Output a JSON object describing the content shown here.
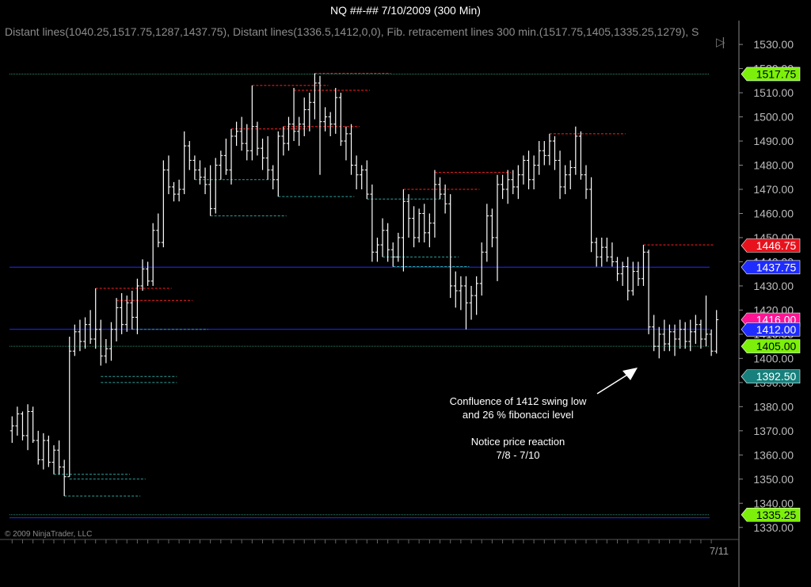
{
  "title": "NQ ##-##  7/10/2009 (300 Min)",
  "subtitle": "Distant lines(1040.25,1517.75,1287,1437.75), Distant lines(1336.5,1412,0,0), Fib. retracement lines 300 min.(1517.75,1405,1335.25,1279), S",
  "copyright": "© 2009 NinjaTrader, LLC",
  "annotation": {
    "lines": [
      "Confluence of 1412 swing low",
      "and 26 % fibonacci level",
      "",
      "Notice price reaction",
      "7/8 - 7/10"
    ]
  },
  "colors": {
    "background": "#000000",
    "bars": "#ffffff",
    "swing_high": "#ff2020",
    "swing_low": "#2aa39c",
    "blue_line": "#1f2cff",
    "fib_line": "#2e8c73",
    "axis": "#bbbbbb"
  },
  "chart_data": {
    "type": "ohlc",
    "instrument": "NQ ##-##",
    "timeframe": "300 Min",
    "y_axis": {
      "min": 1325,
      "max": 1532,
      "ticks": [
        1330,
        1340,
        1350,
        1360,
        1370,
        1380,
        1390,
        1400,
        1410,
        1420,
        1430,
        1440,
        1450,
        1460,
        1470,
        1480,
        1490,
        1500,
        1510,
        1520,
        1530
      ],
      "tick_labels": [
        "1330.00",
        "1340.00",
        "1350.00",
        "1360.00",
        "1370.00",
        "1380.00",
        "1390.00",
        "1400.00",
        "1410.00",
        "1420.00",
        "1430.00",
        "1440.00",
        "1450.00",
        "1460.00",
        "1470.00",
        "1480.00",
        "1490.00",
        "1500.00",
        "1510.00",
        "1520.00",
        "1530.00"
      ]
    },
    "x_axis": {
      "labels": [
        "7/11"
      ]
    },
    "bars": [
      [
        1370,
        1376,
        1365,
        1372
      ],
      [
        1372,
        1380,
        1368,
        1377
      ],
      [
        1377,
        1378,
        1366,
        1368
      ],
      [
        1368,
        1381,
        1362,
        1378
      ],
      [
        1378,
        1380,
        1365,
        1366
      ],
      [
        1366,
        1370,
        1356,
        1358
      ],
      [
        1358,
        1369,
        1354,
        1366
      ],
      [
        1366,
        1368,
        1355,
        1357
      ],
      [
        1357,
        1364,
        1352,
        1362
      ],
      [
        1362,
        1366,
        1352,
        1355
      ],
      [
        1355,
        1358,
        1343,
        1351
      ],
      [
        1351,
        1409,
        1351,
        1403
      ],
      [
        1403,
        1414,
        1401,
        1411
      ],
      [
        1411,
        1416,
        1403,
        1407
      ],
      [
        1407,
        1417,
        1404,
        1414
      ],
      [
        1414,
        1420,
        1406,
        1408
      ],
      [
        1408,
        1429,
        1404,
        1412
      ],
      [
        1412,
        1416,
        1397,
        1401
      ],
      [
        1401,
        1408,
        1398,
        1404
      ],
      [
        1404,
        1415,
        1399,
        1412
      ],
      [
        1412,
        1425,
        1407,
        1421
      ],
      [
        1421,
        1427,
        1410,
        1414
      ],
      [
        1414,
        1426,
        1411,
        1423
      ],
      [
        1423,
        1428,
        1412,
        1417
      ],
      [
        1417,
        1433,
        1410,
        1430
      ],
      [
        1430,
        1441,
        1428,
        1437
      ],
      [
        1437,
        1440,
        1430,
        1432
      ],
      [
        1432,
        1456,
        1430,
        1453
      ],
      [
        1453,
        1460,
        1446,
        1448
      ],
      [
        1448,
        1482,
        1446,
        1478
      ],
      [
        1478,
        1484,
        1468,
        1471
      ],
      [
        1471,
        1473,
        1465,
        1468
      ],
      [
        1468,
        1474,
        1465,
        1470
      ],
      [
        1470,
        1494,
        1468,
        1488
      ],
      [
        1488,
        1490,
        1478,
        1482
      ],
      [
        1482,
        1484,
        1474,
        1478
      ],
      [
        1478,
        1482,
        1472,
        1475
      ],
      [
        1475,
        1479,
        1468,
        1472
      ],
      [
        1472,
        1480,
        1459,
        1462
      ],
      [
        1462,
        1483,
        1460,
        1480
      ],
      [
        1480,
        1486,
        1474,
        1484
      ],
      [
        1484,
        1491,
        1476,
        1478
      ],
      [
        1478,
        1495,
        1472,
        1492
      ],
      [
        1492,
        1498,
        1488,
        1494
      ],
      [
        1494,
        1500,
        1486,
        1489
      ],
      [
        1489,
        1497,
        1482,
        1486
      ],
      [
        1486,
        1513,
        1482,
        1496
      ],
      [
        1496,
        1498,
        1484,
        1487
      ],
      [
        1487,
        1491,
        1478,
        1483
      ],
      [
        1483,
        1492,
        1474,
        1478
      ],
      [
        1478,
        1480,
        1470,
        1474
      ],
      [
        1474,
        1494,
        1467,
        1492
      ],
      [
        1492,
        1496,
        1484,
        1489
      ],
      [
        1489,
        1500,
        1486,
        1497
      ],
      [
        1497,
        1512,
        1490,
        1494
      ],
      [
        1494,
        1500,
        1488,
        1497
      ],
      [
        1497,
        1508,
        1492,
        1503
      ],
      [
        1503,
        1510,
        1494,
        1506
      ],
      [
        1506,
        1518,
        1499,
        1514
      ],
      [
        1514,
        1517,
        1476,
        1498
      ],
      [
        1498,
        1504,
        1494,
        1500
      ],
      [
        1500,
        1502,
        1492,
        1497
      ],
      [
        1497,
        1512,
        1493,
        1508
      ],
      [
        1508,
        1510,
        1488,
        1490
      ],
      [
        1490,
        1496,
        1482,
        1493
      ],
      [
        1493,
        1497,
        1476,
        1480
      ],
      [
        1480,
        1484,
        1470,
        1476
      ],
      [
        1476,
        1480,
        1470,
        1478
      ],
      [
        1478,
        1482,
        1466,
        1468
      ],
      [
        1468,
        1472,
        1440,
        1444
      ],
      [
        1444,
        1450,
        1440,
        1447
      ],
      [
        1447,
        1458,
        1442,
        1453
      ],
      [
        1453,
        1456,
        1440,
        1445
      ],
      [
        1445,
        1448,
        1438,
        1442
      ],
      [
        1442,
        1452,
        1440,
        1450
      ],
      [
        1450,
        1470,
        1436,
        1465
      ],
      [
        1465,
        1468,
        1450,
        1458
      ],
      [
        1458,
        1463,
        1446,
        1450
      ],
      [
        1450,
        1462,
        1448,
        1460
      ],
      [
        1460,
        1464,
        1448,
        1452
      ],
      [
        1452,
        1460,
        1446,
        1456
      ],
      [
        1456,
        1478,
        1450,
        1472
      ],
      [
        1472,
        1475,
        1466,
        1468
      ],
      [
        1468,
        1472,
        1460,
        1464
      ],
      [
        1464,
        1468,
        1425,
        1430
      ],
      [
        1430,
        1436,
        1421,
        1428
      ],
      [
        1428,
        1434,
        1420,
        1430
      ],
      [
        1430,
        1434,
        1412,
        1423
      ],
      [
        1423,
        1430,
        1416,
        1426
      ],
      [
        1426,
        1434,
        1418,
        1431
      ],
      [
        1431,
        1448,
        1426,
        1444
      ],
      [
        1444,
        1464,
        1440,
        1459
      ],
      [
        1459,
        1462,
        1446,
        1450
      ],
      [
        1450,
        1476,
        1432,
        1472
      ],
      [
        1472,
        1476,
        1466,
        1470
      ],
      [
        1470,
        1478,
        1464,
        1474
      ],
      [
        1474,
        1478,
        1468,
        1471
      ],
      [
        1471,
        1480,
        1466,
        1476
      ],
      [
        1476,
        1484,
        1472,
        1482
      ],
      [
        1482,
        1486,
        1470,
        1474
      ],
      [
        1474,
        1484,
        1470,
        1480
      ],
      [
        1480,
        1490,
        1476,
        1486
      ],
      [
        1486,
        1490,
        1480,
        1484
      ],
      [
        1484,
        1493,
        1480,
        1490
      ],
      [
        1490,
        1492,
        1478,
        1482
      ],
      [
        1482,
        1486,
        1466,
        1471
      ],
      [
        1471,
        1480,
        1468,
        1476
      ],
      [
        1476,
        1482,
        1470,
        1479
      ],
      [
        1479,
        1496,
        1476,
        1492
      ],
      [
        1492,
        1494,
        1474,
        1476
      ],
      [
        1476,
        1480,
        1466,
        1470
      ],
      [
        1470,
        1475,
        1444,
        1448
      ],
      [
        1448,
        1450,
        1438,
        1442
      ],
      [
        1442,
        1450,
        1438,
        1446
      ],
      [
        1446,
        1450,
        1440,
        1442
      ],
      [
        1442,
        1448,
        1438,
        1440
      ],
      [
        1440,
        1442,
        1432,
        1435
      ],
      [
        1435,
        1440,
        1430,
        1438
      ],
      [
        1438,
        1442,
        1424,
        1428
      ],
      [
        1428,
        1440,
        1426,
        1436
      ],
      [
        1436,
        1440,
        1430,
        1433
      ],
      [
        1433,
        1447,
        1430,
        1444
      ],
      [
        1444,
        1445,
        1410,
        1413
      ],
      [
        1413,
        1418,
        1403,
        1405
      ],
      [
        1405,
        1413,
        1400,
        1410
      ],
      [
        1410,
        1416,
        1403,
        1406
      ],
      [
        1406,
        1414,
        1403,
        1411
      ],
      [
        1411,
        1414,
        1401,
        1408
      ],
      [
        1408,
        1416,
        1404,
        1412
      ],
      [
        1412,
        1415,
        1404,
        1407
      ],
      [
        1407,
        1416,
        1403,
        1411
      ],
      [
        1411,
        1418,
        1406,
        1414
      ],
      [
        1414,
        1416,
        1404,
        1408
      ],
      [
        1408,
        1426,
        1405,
        1410
      ],
      [
        1410,
        1412,
        1401,
        1403
      ],
      [
        1403,
        1420,
        1402,
        1416
      ]
    ],
    "levels": [
      {
        "value": 1517.75,
        "label": "1517.75",
        "kind": "fib"
      },
      {
        "value": 1446.75,
        "label": "1446.75",
        "kind": "swing_high"
      },
      {
        "value": 1437.75,
        "label": "1437.75",
        "kind": "distant_line"
      },
      {
        "value": 1416.0,
        "label": "1416.00",
        "kind": "price"
      },
      {
        "value": 1412.0,
        "label": "1412.00",
        "kind": "distant_line"
      },
      {
        "value": 1405.0,
        "label": "1405.00",
        "kind": "fib"
      },
      {
        "value": 1392.5,
        "label": "1392.50",
        "kind": "swing_low"
      },
      {
        "value": 1335.25,
        "label": "1335.25",
        "kind": "fib"
      }
    ],
    "swing_highs": [
      1424,
      1429,
      1495,
      1513,
      1518,
      1511,
      1470,
      1477,
      1493,
      1496,
      1447
    ],
    "swing_lows": [
      1352,
      1350,
      1343,
      1390,
      1459,
      1467,
      1474,
      1442,
      1438,
      1412,
      1466,
      1438,
      1392.5
    ]
  }
}
